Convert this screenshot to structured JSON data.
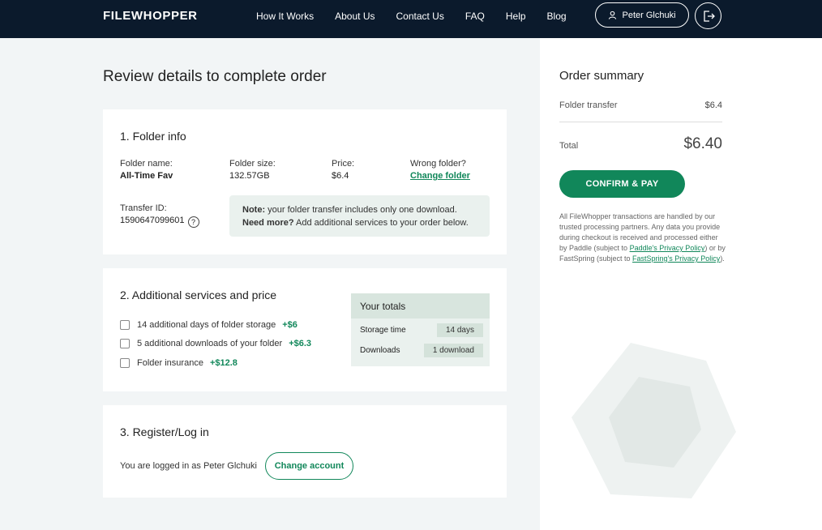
{
  "header": {
    "logo": "FILEWHOPPER",
    "nav": [
      "How It Works",
      "About Us",
      "Contact Us",
      "FAQ",
      "Help",
      "Blog"
    ],
    "user_name": "Peter Glchuki"
  },
  "page_title": "Review details to complete order",
  "folder_info": {
    "title": "1. Folder info",
    "name_label": "Folder name:",
    "name_value": "All-Time Fav",
    "size_label": "Folder size:",
    "size_value": "132.57GB",
    "price_label": "Price:",
    "price_value": "$6.4",
    "wrong_label": "Wrong folder?",
    "change_link": "Change folder",
    "transfer_label": "Transfer ID:",
    "transfer_value": "1590647099601",
    "note_bold": "Note:",
    "note_text": " your folder transfer includes only one download.",
    "need_more_bold": "Need more?",
    "need_more_text": " Add additional services to your order below."
  },
  "services": {
    "title": "2. Additional services and price",
    "items": [
      {
        "label": "14 additional days of folder storage",
        "price": "+$6"
      },
      {
        "label": "5 additional downloads of your folder",
        "price": "+$6.3"
      },
      {
        "label": "Folder insurance",
        "price": "+$12.8"
      }
    ],
    "totals_title": "Your totals",
    "storage_label": "Storage time",
    "storage_value": "14 days",
    "downloads_label": "Downloads",
    "downloads_value": "1 download"
  },
  "register": {
    "title": "3. Register/Log in",
    "logged_text": "You are logged in as Peter Glchuki",
    "change_account": "Change account"
  },
  "summary": {
    "title": "Order summary",
    "folder_transfer_label": "Folder transfer",
    "folder_transfer_value": "$6.4",
    "total_label": "Total",
    "total_value": "$6.40",
    "confirm_label": "CONFIRM & PAY",
    "disclaimer_1": "All FileWhopper transactions are handled by our trusted processing partners. Any data you provide during checkout is received and processed either by Paddle (subject to ",
    "paddle_link": "Paddle's Privacy Policy",
    "disclaimer_2": ") or by FastSpring (subject to ",
    "fastspring_link": "FastSpring's Privacy Policy",
    "disclaimer_3": ")."
  },
  "colors": {
    "header_bg": "#0b1a2c",
    "accent_green": "#11875a",
    "page_bg": "#f2f5f6"
  }
}
